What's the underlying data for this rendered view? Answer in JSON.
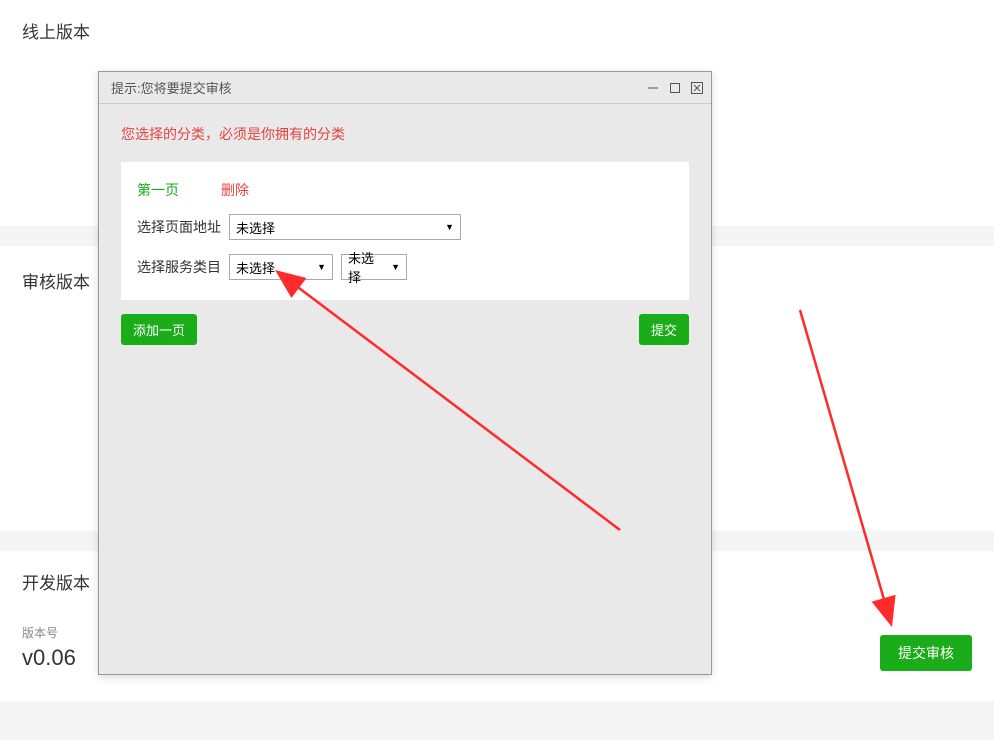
{
  "sections": {
    "online_title": "线上版本",
    "review_title": "审核版本",
    "dev_title": "开发版本"
  },
  "version": {
    "caption": "版本号",
    "number": "v0.06"
  },
  "buttons": {
    "submit_review": "提交审核",
    "add_page": "添加一页",
    "submit": "提交"
  },
  "dialog": {
    "title": "提示:您将要提交审核",
    "warning": "您选择的分类，必须是你拥有的分类",
    "page_label": "第一页",
    "delete_label": "删除",
    "row_page_address_label": "选择页面地址",
    "row_service_cat_label": "选择服务类目",
    "select_placeholder": "未选择"
  }
}
